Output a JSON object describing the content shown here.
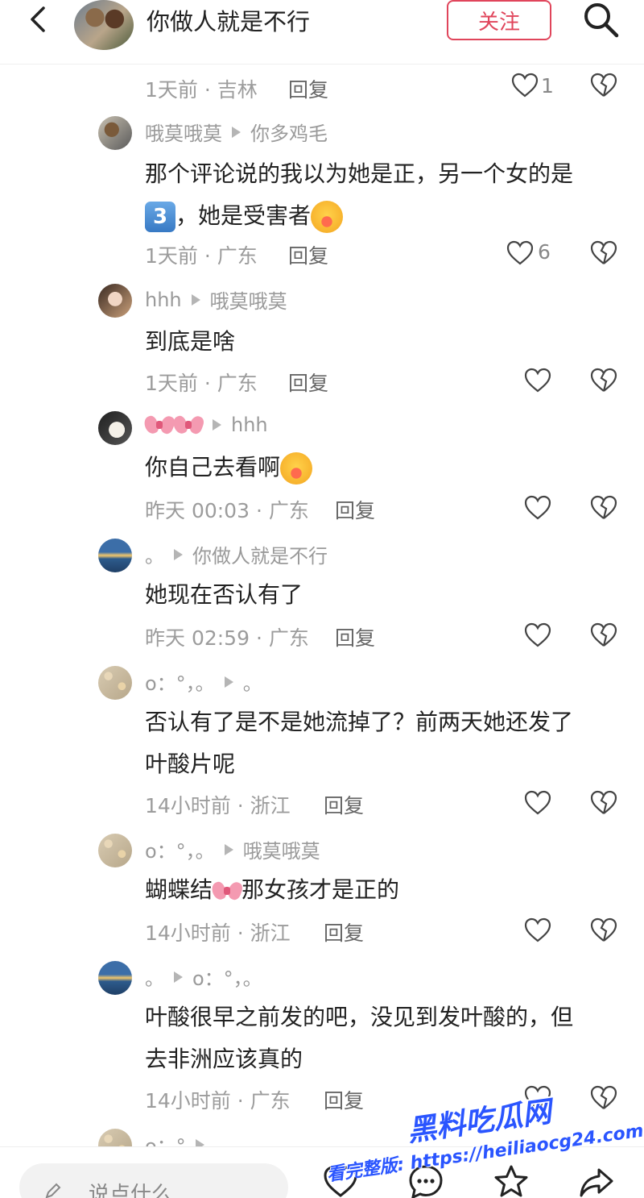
{
  "header": {
    "title": "你做人就是不行",
    "follow_label": "关注"
  },
  "top_meta": {
    "time_loc": "1天前 · 吉林",
    "reply": "回复",
    "likes": "1"
  },
  "comments": [
    {
      "author": "哦莫哦莫",
      "reply_to": "你多鸡毛",
      "text_line1": "那个评论说的我以为她是正，另一个女的是",
      "badge": "3",
      "text_line2": "，她是受害者",
      "time_loc": "1天前 · 广东",
      "reply": "回复",
      "likes": "6"
    },
    {
      "author": "hhh",
      "reply_to": "哦莫哦莫",
      "text": "到底是啥",
      "time_loc": "1天前 · 广东",
      "reply": "回复"
    },
    {
      "reply_to": "hhh",
      "text": "你自己去看啊",
      "time_loc": "昨天 00:03 · 广东",
      "reply": "回复"
    },
    {
      "author": "。",
      "reply_to": "你做人就是不行",
      "text": "她现在否认有了",
      "time_loc": "昨天 02:59 · 广东",
      "reply": "回复"
    },
    {
      "author": "o：°，。",
      "reply_to": "。",
      "text_line1": "否认有了是不是她流掉了？前两天她还发了",
      "text_line2": "叶酸片呢",
      "time_loc": "14小时前 · 浙江",
      "reply": "回复"
    },
    {
      "author": "o：°，。",
      "reply_to": "哦莫哦莫",
      "text_a": "蝴蝶结",
      "text_b": "那女孩才是正的",
      "time_loc": "14小时前 · 浙江",
      "reply": "回复"
    },
    {
      "author": "。",
      "reply_to": "o：°，。",
      "text_line1": "叶酸很早之前发的吧，没见到发叶酸的，但",
      "text_line2": "去非洲应该真的",
      "time_loc": "14小时前 · 广东",
      "reply": "回复"
    },
    {
      "author": "o：°",
      "reply_to": ""
    }
  ],
  "bottom": {
    "placeholder": "说点什么"
  },
  "watermark": {
    "title": "黑料吃瓜网",
    "subtitle": "看完整版: https://heiliaocg24.com"
  },
  "colors": {
    "accent": "#e0455b",
    "watermark": "#2a55ff"
  },
  "icons": [
    "back-arrow-icon",
    "search-icon",
    "heart-icon",
    "broken-heart-icon",
    "pencil-icon",
    "comment-icon",
    "star-icon",
    "share-icon"
  ]
}
